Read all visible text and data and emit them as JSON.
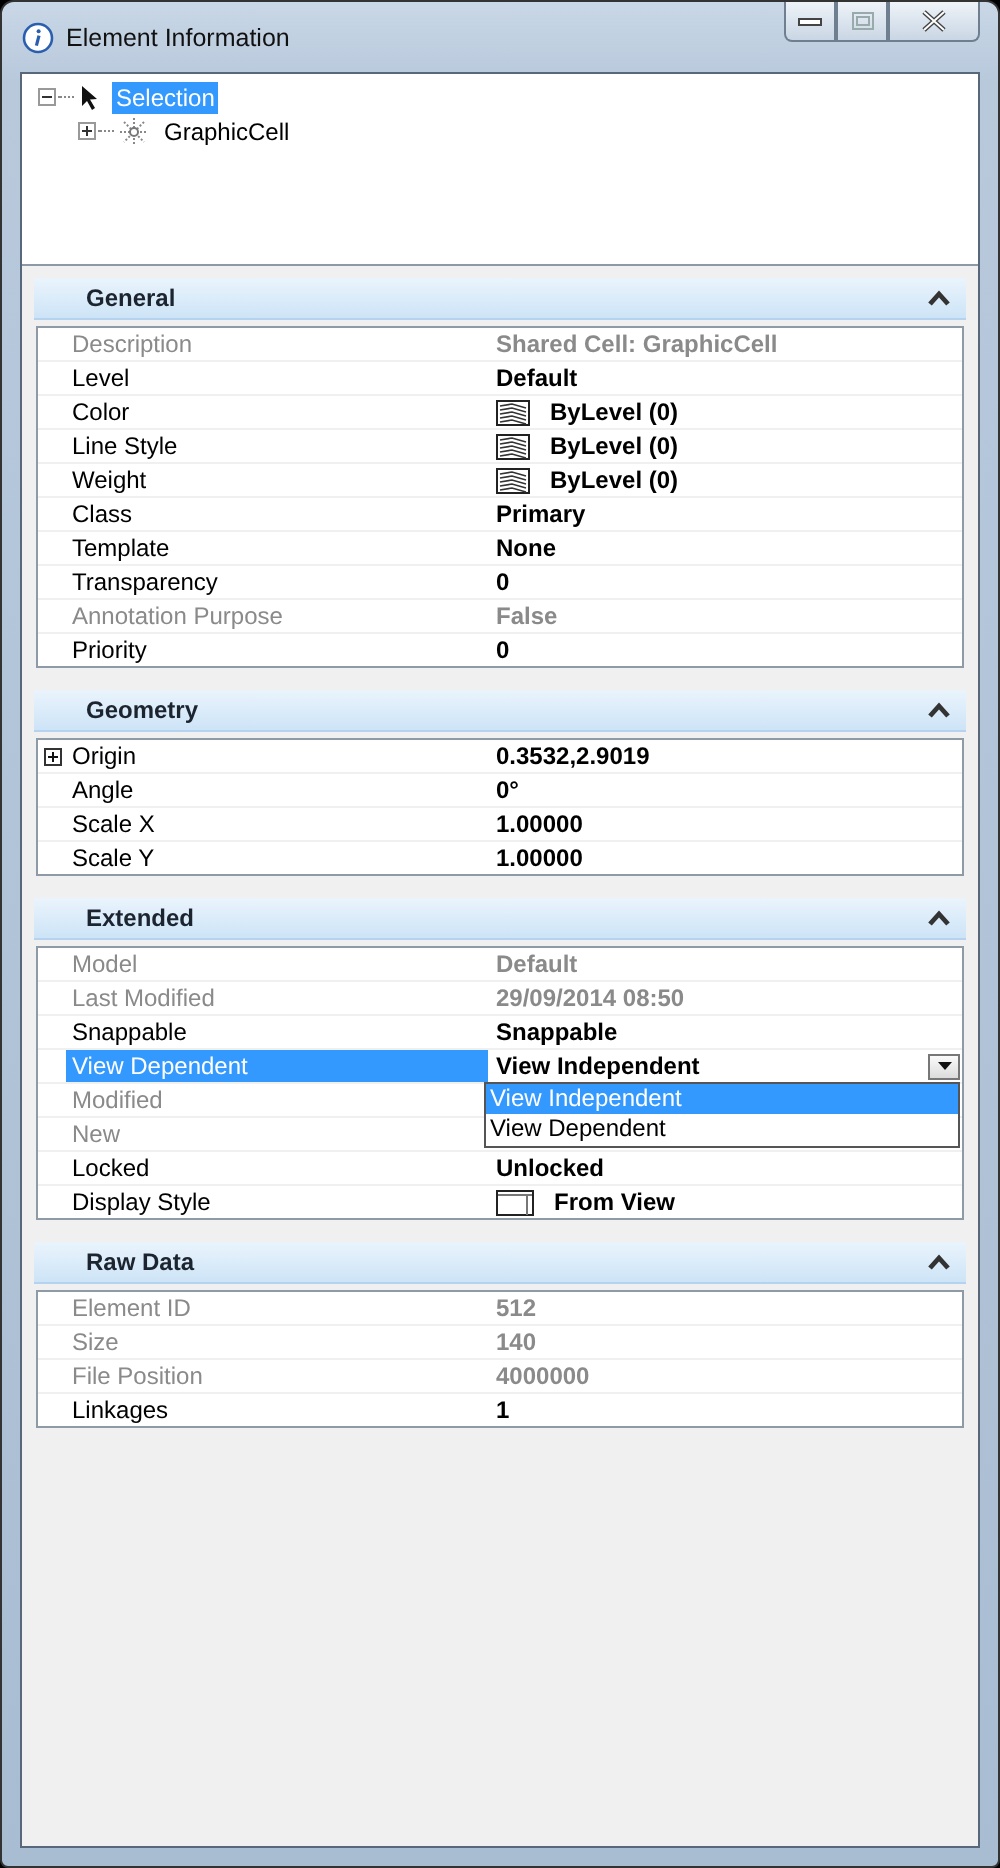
{
  "window": {
    "title": "Element Information"
  },
  "tree": [
    {
      "label": "Selection",
      "selected": true,
      "expanded": true,
      "kind": "pointer",
      "children": [
        {
          "label": "GraphicCell",
          "selected": false,
          "expanded": false,
          "kind": "cell"
        }
      ]
    }
  ],
  "sections": [
    {
      "title": "General",
      "expanded": true,
      "rows": [
        {
          "label": "Description",
          "value": "Shared Cell: GraphicCell",
          "disabled": true,
          "selected": false
        },
        {
          "label": "Level",
          "value": "Default",
          "disabled": false,
          "selected": false
        },
        {
          "label": "Color",
          "value": "ByLevel (0)",
          "kind": "layers",
          "disabled": false,
          "selected": false
        },
        {
          "label": "Line Style",
          "value": "ByLevel (0)",
          "kind": "layers",
          "disabled": false,
          "selected": false
        },
        {
          "label": "Weight",
          "value": "ByLevel (0)",
          "kind": "layers",
          "disabled": false,
          "selected": false
        },
        {
          "label": "Class",
          "value": "Primary",
          "disabled": false,
          "selected": false
        },
        {
          "label": "Template",
          "value": "None",
          "disabled": false,
          "selected": false
        },
        {
          "label": "Transparency",
          "value": "0",
          "disabled": false,
          "selected": false
        },
        {
          "label": "Annotation Purpose",
          "value": "False",
          "disabled": true,
          "selected": false
        },
        {
          "label": "Priority",
          "value": "0",
          "disabled": false,
          "selected": false
        }
      ]
    },
    {
      "title": "Geometry",
      "expanded": true,
      "rows": [
        {
          "label": "Origin",
          "value": "0.3532,2.9019",
          "disabled": false,
          "selected": false,
          "expanded": false
        },
        {
          "label": "Angle",
          "value": "0°",
          "disabled": false,
          "selected": false
        },
        {
          "label": "Scale X",
          "value": "1.00000",
          "disabled": false,
          "selected": false
        },
        {
          "label": "Scale Y",
          "value": "1.00000",
          "disabled": false,
          "selected": false
        }
      ]
    },
    {
      "title": "Extended",
      "expanded": true,
      "rows": [
        {
          "label": "Model",
          "value": "Default",
          "disabled": true,
          "selected": false
        },
        {
          "label": "Last Modified",
          "value": "29/09/2014 08:50",
          "disabled": true,
          "selected": false
        },
        {
          "label": "Snappable",
          "value": "Snappable",
          "disabled": false,
          "selected": false
        },
        {
          "label": "View Dependent",
          "value": "View Independent",
          "disabled": false,
          "selected": true,
          "dropdown": {
            "open": true,
            "options": [
              {
                "label": "View Independent",
                "selected": true
              },
              {
                "label": "View Dependent",
                "selected": false
              }
            ]
          }
        },
        {
          "label": "Modified",
          "disabled": true,
          "selected": false
        },
        {
          "label": "New",
          "disabled": true,
          "selected": false
        },
        {
          "label": "Locked",
          "value": "Unlocked",
          "disabled": false,
          "selected": false
        },
        {
          "label": "Display Style",
          "value": "From View",
          "kind": "display",
          "disabled": false,
          "selected": false
        }
      ]
    },
    {
      "title": "Raw Data",
      "expanded": true,
      "rows": [
        {
          "label": "Element ID",
          "value": "512",
          "disabled": true,
          "selected": false
        },
        {
          "label": "Size",
          "value": "140",
          "disabled": true,
          "selected": false
        },
        {
          "label": "File Position",
          "value": "4000000",
          "disabled": true,
          "selected": false
        },
        {
          "label": "Linkages",
          "value": "1",
          "disabled": false,
          "selected": false
        }
      ]
    }
  ]
}
